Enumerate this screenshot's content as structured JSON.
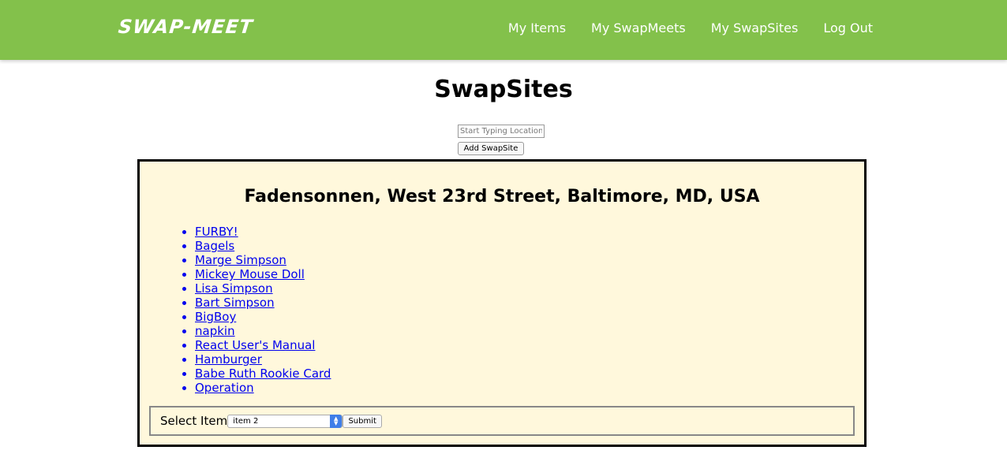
{
  "navbar": {
    "logo": "SWAP-MEET",
    "links": [
      {
        "label": "My Items"
      },
      {
        "label": "My SwapMeets"
      },
      {
        "label": "My SwapSites"
      },
      {
        "label": "Log Out"
      }
    ],
    "background": "#83c14b"
  },
  "page": {
    "title": "SwapSites",
    "search_placeholder": "Start Typing Location",
    "add_button": "Add SwapSite"
  },
  "site": {
    "name": "Fadensonnen, West 23rd Street, Baltimore, MD, USA",
    "background": "#fff8dc",
    "items": [
      {
        "label": "FURBY!"
      },
      {
        "label": "Bagels"
      },
      {
        "label": "Marge Simpson"
      },
      {
        "label": "Mickey Mouse Doll"
      },
      {
        "label": "Lisa Simpson"
      },
      {
        "label": "Bart Simpson"
      },
      {
        "label": "BigBoy"
      },
      {
        "label": "napkin"
      },
      {
        "label": "React User's Manual"
      },
      {
        "label": "Hamburger"
      },
      {
        "label": "Babe Ruth Rookie Card"
      },
      {
        "label": "Operation"
      }
    ],
    "form": {
      "label": "Select Item",
      "selected": "item 2",
      "submit": "Submit"
    }
  }
}
